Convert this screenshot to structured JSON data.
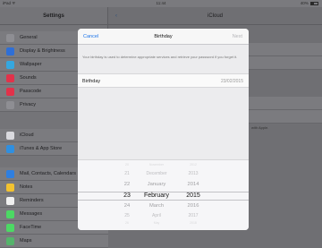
{
  "status": {
    "device": "iPad ᯤ",
    "time": "11:44",
    "battery": "40% "
  },
  "sidebar": {
    "title": "Settings",
    "items": [
      {
        "label": "General",
        "color": "#8e8e93"
      },
      {
        "label": "Display & Brightness",
        "color": "#2f6fd6"
      },
      {
        "label": "Wallpaper",
        "color": "#35a7df"
      },
      {
        "label": "Sounds",
        "color": "#e2324a"
      },
      {
        "label": "Passcode",
        "color": "#e2324a"
      },
      {
        "label": "Privacy",
        "color": "#8e8e93"
      },
      {
        "label": "iCloud",
        "color": "#d9d9de"
      },
      {
        "label": "iTunes & App Store",
        "color": "#2f8fe0"
      },
      {
        "label": "Mail, Contacts, Calendars",
        "color": "#2f7fe0"
      },
      {
        "label": "Notes",
        "color": "#f2c230"
      },
      {
        "label": "Reminders",
        "color": "#f0f0f0"
      },
      {
        "label": "Messages",
        "color": "#4cd964"
      },
      {
        "label": "FaceTime",
        "color": "#4cd964"
      },
      {
        "label": "Maps",
        "color": "#55b36b"
      }
    ]
  },
  "main": {
    "title": "iCloud",
    "back_label": "‹",
    "note": "with Apple."
  },
  "modal": {
    "cancel_label": "Cancel",
    "title": "Birthday",
    "next_label": "Next",
    "description": "Your birthday is used to determine appropriate services and retrieve your password if you forget it.",
    "field_label": "Birthday",
    "field_value": "23/02/2015"
  },
  "picker": {
    "days": [
      "20",
      "21",
      "22",
      "23",
      "24",
      "25",
      "26"
    ],
    "months": [
      "November",
      "December",
      "January",
      "February",
      "March",
      "April",
      "May"
    ],
    "years": [
      "2012",
      "2013",
      "2014",
      "2015",
      "2016",
      "2017",
      "2018"
    ]
  }
}
